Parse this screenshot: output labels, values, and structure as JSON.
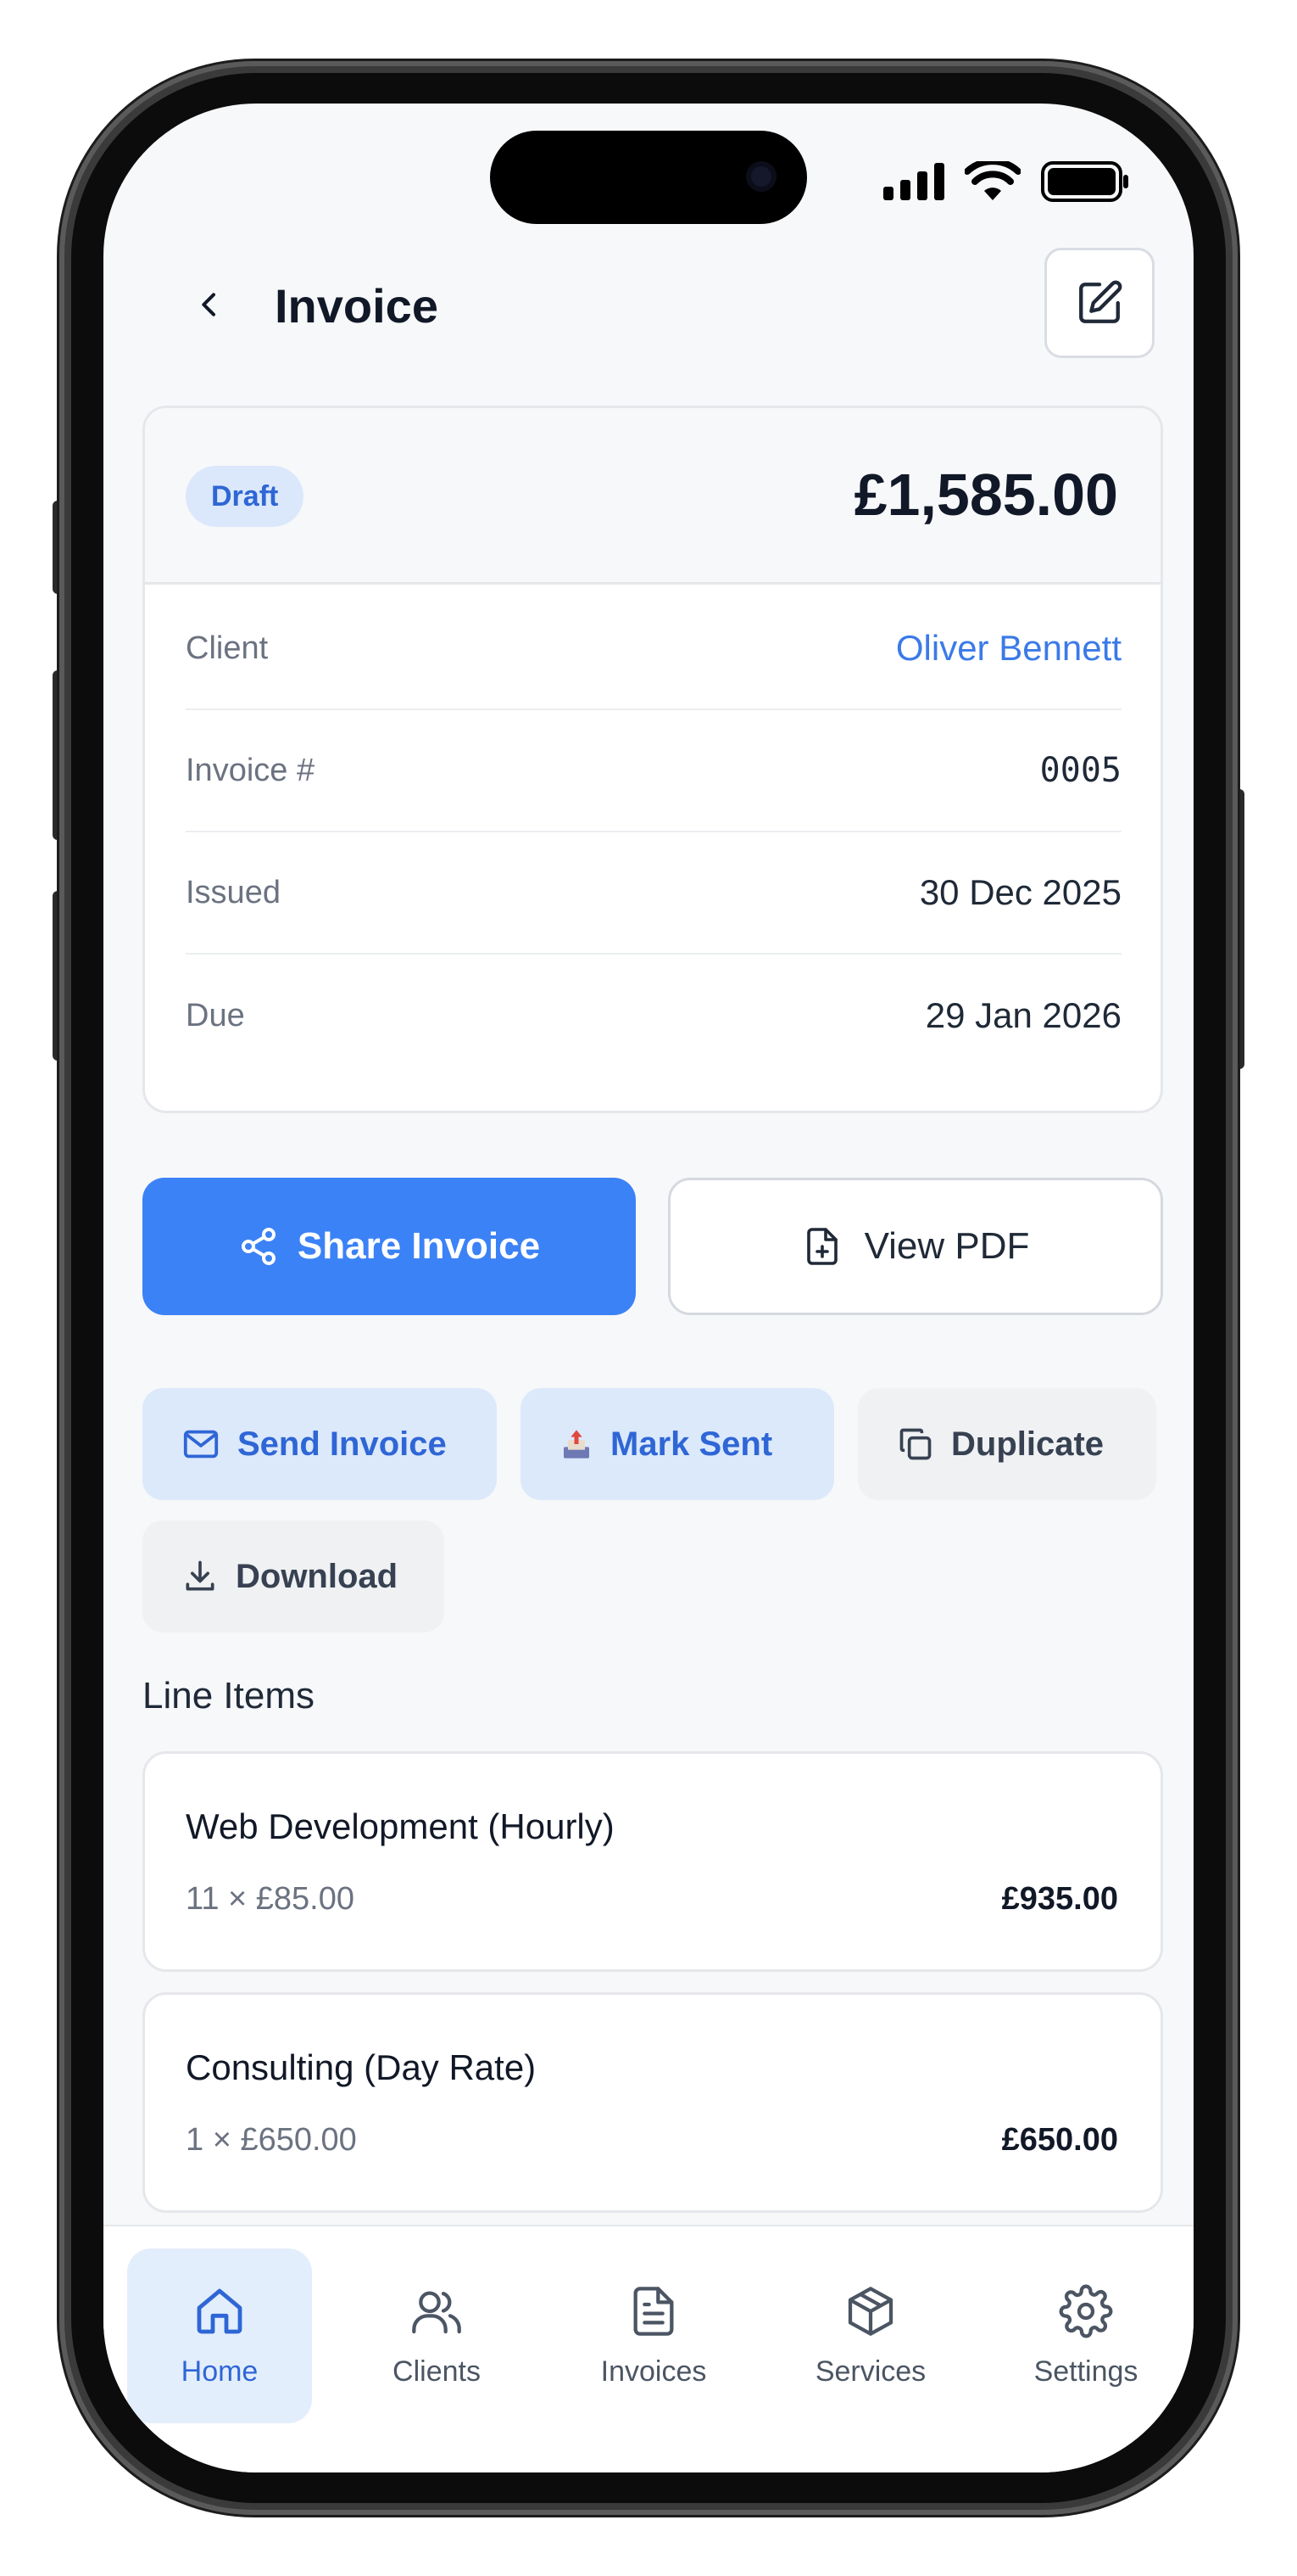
{
  "header": {
    "title": "Invoice"
  },
  "summary": {
    "status_badge": "Draft",
    "amount": "£1,585.00",
    "rows": [
      {
        "label": "Client",
        "value": "Oliver Bennett"
      },
      {
        "label": "Invoice #",
        "value": "0005"
      },
      {
        "label": "Issued",
        "value": "30 Dec 2025"
      },
      {
        "label": "Due",
        "value": "29 Jan 2026"
      }
    ]
  },
  "actions": {
    "share": "Share Invoice",
    "view_pdf": "View PDF",
    "send": "Send Invoice",
    "mark_sent": "Mark Sent",
    "duplicate": "Duplicate",
    "download": "Download"
  },
  "line_items": {
    "title": "Line Items",
    "items": [
      {
        "name": "Web Development (Hourly)",
        "qty": "11 × £85.00",
        "total": "£935.00"
      },
      {
        "name": "Consulting (Day Rate)",
        "qty": "1 × £650.00",
        "total": "£650.00"
      }
    ]
  },
  "tabbar": {
    "tabs": [
      {
        "label": "Home",
        "icon": "home-icon",
        "active": true
      },
      {
        "label": "Clients",
        "icon": "users-icon",
        "active": false
      },
      {
        "label": "Invoices",
        "icon": "document-icon",
        "active": false
      },
      {
        "label": "Services",
        "icon": "package-icon",
        "active": false
      },
      {
        "label": "Settings",
        "icon": "gear-icon",
        "active": false
      }
    ]
  },
  "colors": {
    "accent": "#3b82f6",
    "link": "#3b7ae8",
    "badge_bg": "#dbe8fb",
    "background": "#f7f8fa"
  }
}
